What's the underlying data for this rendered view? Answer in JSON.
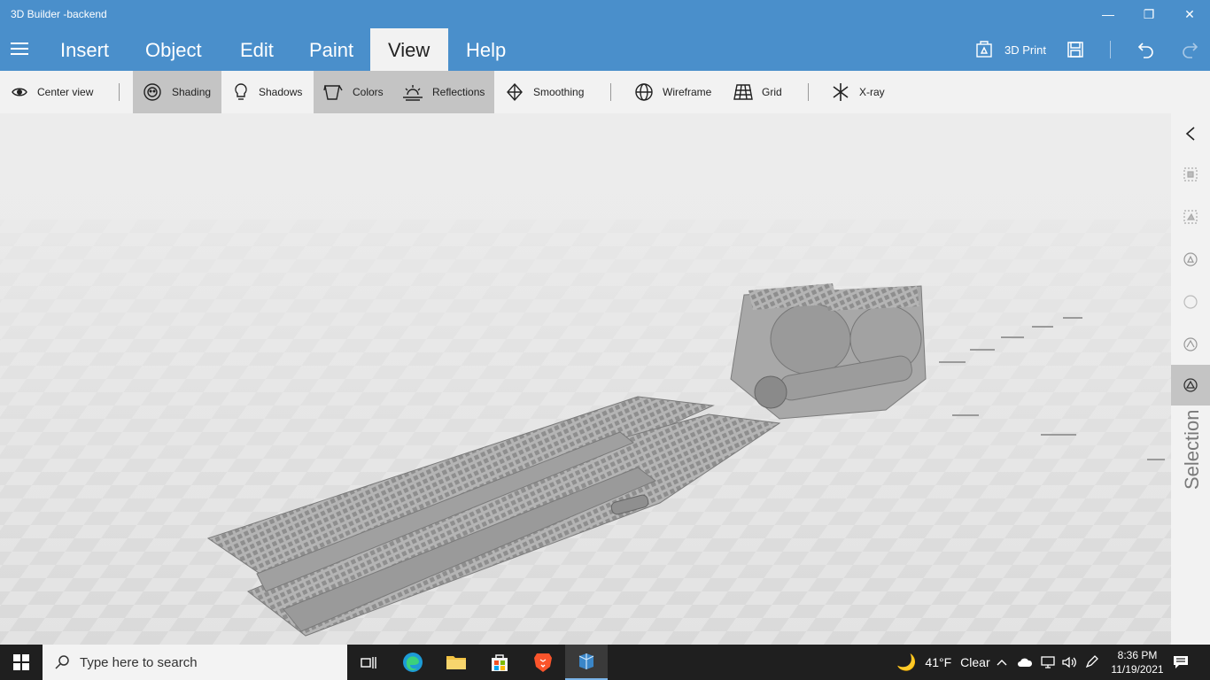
{
  "window": {
    "title": "3D Builder -backend",
    "minimize": "—",
    "restore": "❐",
    "close": "✕"
  },
  "menu": {
    "items": [
      "Insert",
      "Object",
      "Edit",
      "Paint",
      "View",
      "Help"
    ],
    "active": "View",
    "print_label": "3D Print"
  },
  "toolbar": {
    "center_view": "Center view",
    "shading": "Shading",
    "shadows": "Shadows",
    "colors": "Colors",
    "reflections": "Reflections",
    "smoothing": "Smoothing",
    "wireframe": "Wireframe",
    "grid": "Grid",
    "xray": "X-ray",
    "active": [
      "Shading",
      "Colors",
      "Reflections"
    ]
  },
  "side_panel": {
    "label": "Selection"
  },
  "taskbar": {
    "search_placeholder": "Type here to search",
    "weather_temp": "41°F",
    "weather_desc": "Clear",
    "time": "8:36 PM",
    "date": "11/19/2021"
  },
  "colors": {
    "accent": "#4a8fcb",
    "toolbar": "#f2f2f2",
    "active_tool": "#c4c4c4",
    "taskbar": "#1f1f1f"
  }
}
